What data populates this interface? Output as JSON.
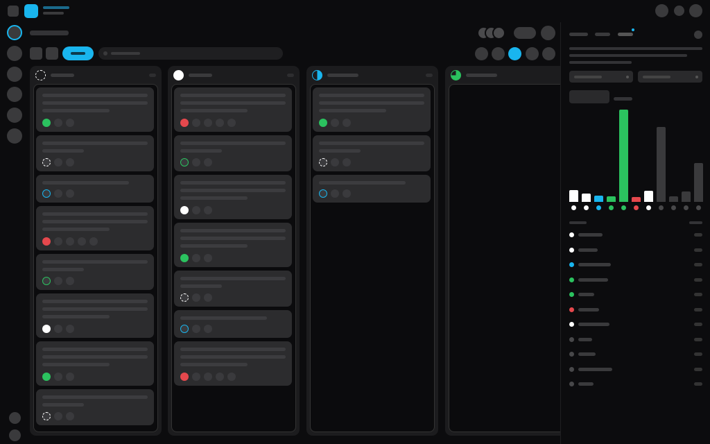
{
  "app": {
    "accent": "#19b5ee",
    "background": "#0c0c0e"
  },
  "status_colors": {
    "done": "#2bc25f",
    "urgent": "#e5484d",
    "todo": "#ffffff",
    "in_progress": "#19b5ee",
    "neutral": "#3a3a3c"
  },
  "toolbar": {
    "active_view": "board"
  },
  "board": {
    "columns": [
      {
        "status_icon": "dashed-circle-icon",
        "cards": [
          {
            "status": "done-icon",
            "lines": 3
          },
          {
            "status": "dashed-circle-icon",
            "lines": 2
          },
          {
            "status": "half-circle-icon",
            "lines": 1
          },
          {
            "status": "urgent-icon",
            "lines": 3
          },
          {
            "status": "quarter-circle-icon",
            "lines": 2
          },
          {
            "status": "todo-icon",
            "lines": 3
          },
          {
            "status": "done-icon",
            "lines": 3
          },
          {
            "status": "dashed-circle-icon",
            "lines": 2
          }
        ]
      },
      {
        "status_icon": "todo-icon",
        "cards": [
          {
            "status": "urgent-icon",
            "lines": 3
          },
          {
            "status": "quarter-circle-icon",
            "lines": 2
          },
          {
            "status": "todo-icon",
            "lines": 3
          },
          {
            "status": "done-icon",
            "lines": 3
          },
          {
            "status": "dashed-circle-icon",
            "lines": 2
          },
          {
            "status": "half-circle-icon",
            "lines": 1
          },
          {
            "status": "urgent-icon",
            "lines": 3
          }
        ]
      },
      {
        "status_icon": "half-circle-icon",
        "cards": [
          {
            "status": "done-icon",
            "lines": 3
          },
          {
            "status": "dashed-circle-icon",
            "lines": 2
          },
          {
            "status": "half-circle-icon",
            "lines": 1
          }
        ]
      },
      {
        "status_icon": "quarter-circle-icon",
        "cards": []
      }
    ]
  },
  "chart_data": {
    "type": "bar",
    "values": [
      0.13,
      0.09,
      0.07,
      0.06,
      1.0,
      0.05,
      0.12,
      0.81,
      0.06,
      0.11,
      0.42
    ],
    "colors": [
      "#ffffff",
      "#ffffff",
      "#19b5ee",
      "#2bc25f",
      "#2bc25f",
      "#e5484d",
      "#ffffff",
      "#3a3a3c",
      "#3a3a3c",
      "#3a3a3c",
      "#3a3a3c"
    ]
  },
  "legend": {
    "items": [
      {
        "color": "#ffffff"
      },
      {
        "color": "#ffffff"
      },
      {
        "color": "#19b5ee"
      },
      {
        "color": "#2bc25f"
      },
      {
        "color": "#2bc25f"
      },
      {
        "color": "#e5484d"
      },
      {
        "color": "#ffffff"
      },
      {
        "color": "#3a3a3c"
      },
      {
        "color": "#3a3a3c"
      },
      {
        "color": "#3a3a3c"
      },
      {
        "color": "#3a3a3c"
      }
    ]
  }
}
